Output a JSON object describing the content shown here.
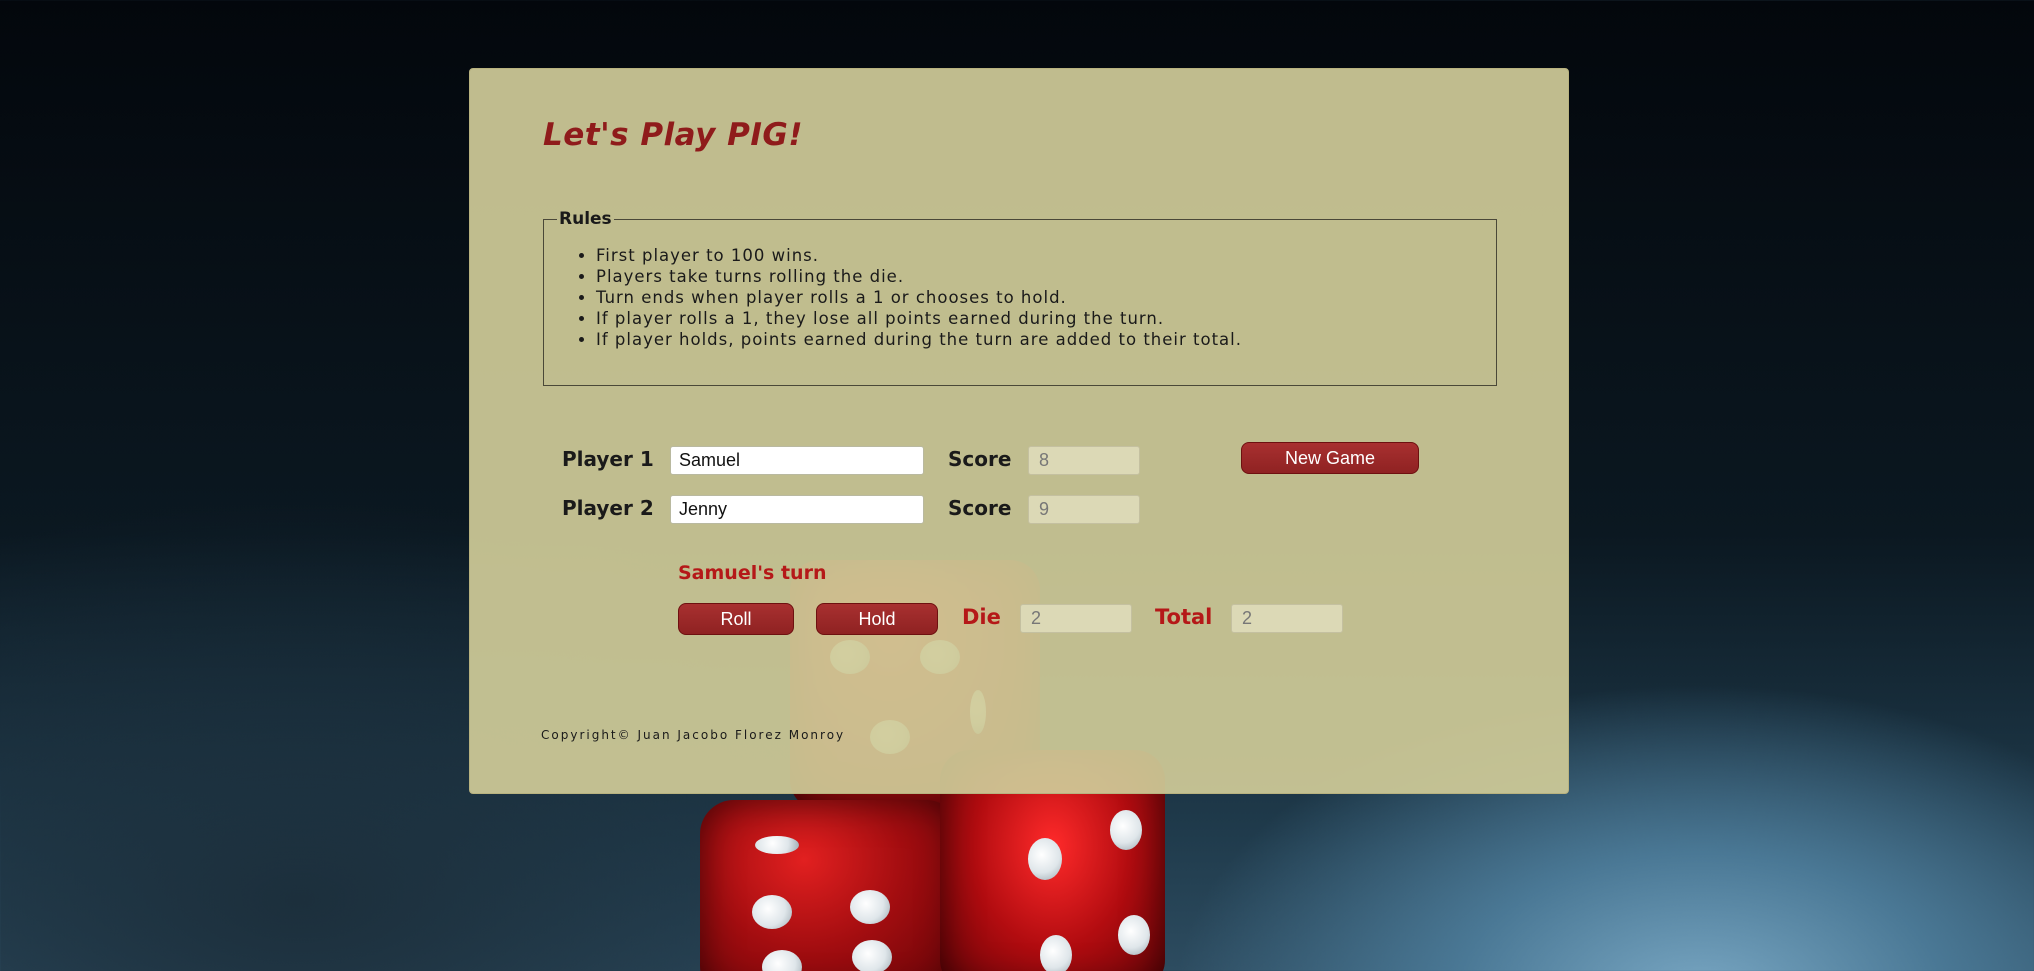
{
  "page": {
    "title": "Let's Play PIG!",
    "accent_color": "#8f1b1b",
    "button_color": "#9a2626",
    "panel_color": "#cfca98"
  },
  "rules": {
    "legend": "Rules",
    "items": [
      "First player to 100 wins.",
      "Players take turns rolling the die.",
      "Turn ends when player rolls a 1 or chooses to hold.",
      "If player rolls a 1, they lose all points earned during the turn.",
      "If player holds, points earned during the turn are added to their total."
    ]
  },
  "players": [
    {
      "label": "Player 1",
      "name": "Samuel",
      "score_label": "Score",
      "score": "8"
    },
    {
      "label": "Player 2",
      "name": "Jenny",
      "score_label": "Score",
      "score": "9"
    }
  ],
  "controls": {
    "new_game_label": "New Game",
    "turn_text": "Samuel's turn",
    "roll_label": "Roll",
    "hold_label": "Hold",
    "die_label": "Die",
    "die_value": "2",
    "total_label": "Total",
    "total_value": "2"
  },
  "footer": {
    "copyright": "Copyright© Juan Jacobo Florez Monroy"
  }
}
